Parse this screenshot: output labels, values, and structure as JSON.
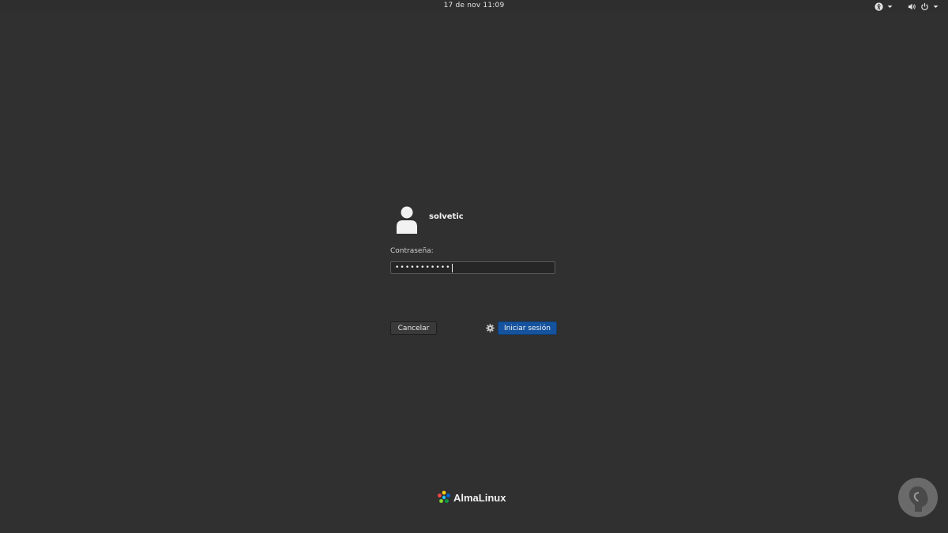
{
  "topbar": {
    "clock": "17 de nov  11:09",
    "icons": [
      "accessibility-icon",
      "volume-icon",
      "power-icon"
    ]
  },
  "login": {
    "username": "solvetic",
    "password_label": "Contraseña:",
    "password_mask": "•••••••••••",
    "cancel_label": "Cancelar",
    "login_label": "Iniciar sesión",
    "session_icon": "gear-icon"
  },
  "branding": {
    "name": "AlmaLinux"
  },
  "colors": {
    "background": "#303030",
    "accent": "#15539e",
    "text": "#e8e8e8"
  }
}
